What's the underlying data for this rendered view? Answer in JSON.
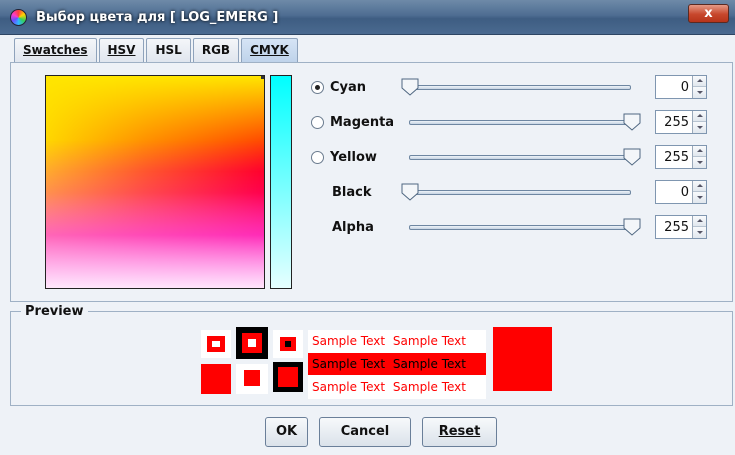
{
  "window": {
    "title": "Выбор цвета для [ LOG_EMERG ]",
    "close_label": "x"
  },
  "tabs": [
    {
      "label": "Swatches",
      "selected": false
    },
    {
      "label": "HSV",
      "selected": false
    },
    {
      "label": "HSL",
      "selected": false
    },
    {
      "label": "RGB",
      "selected": false
    },
    {
      "label": "CMYK",
      "selected": true
    }
  ],
  "sliders": [
    {
      "label": "Cyan",
      "has_radio": true,
      "checked": true,
      "value": "0",
      "level": 0.0
    },
    {
      "label": "Magenta",
      "has_radio": true,
      "checked": false,
      "value": "255",
      "level": 1.0
    },
    {
      "label": "Yellow",
      "has_radio": true,
      "checked": false,
      "value": "255",
      "level": 1.0
    },
    {
      "label": "Black",
      "has_radio": false,
      "checked": false,
      "value": "0",
      "level": 0.0
    },
    {
      "label": "Alpha",
      "has_radio": false,
      "checked": false,
      "value": "255",
      "level": 1.0
    }
  ],
  "preview": {
    "label": "Preview",
    "sample_text": "Sample Text",
    "selected_color": "#ff0000"
  },
  "buttons": {
    "ok": "OK",
    "cancel": "Cancel",
    "reset": "Reset"
  },
  "colors": {
    "accent": "#ff0000",
    "title_bar": "#4e6d92",
    "body_bg": "#eef2f7"
  }
}
